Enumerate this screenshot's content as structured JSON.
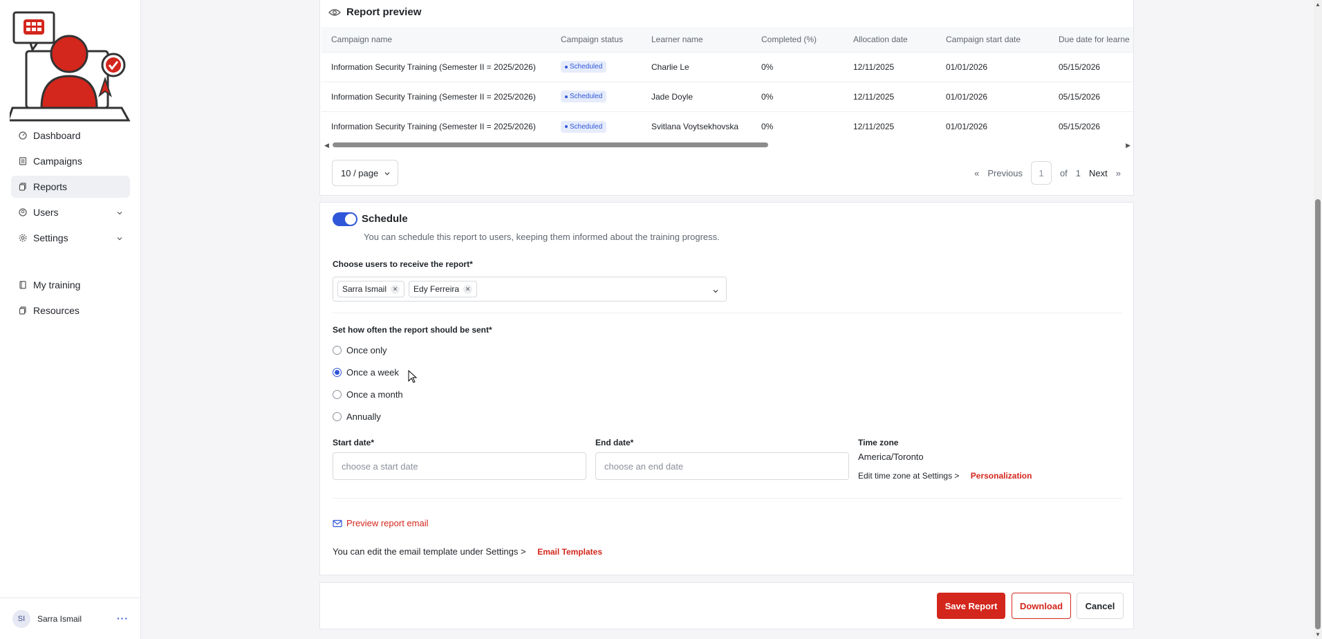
{
  "sidebar": {
    "items": [
      {
        "label": "Dashboard",
        "icon": "gauge-icon"
      },
      {
        "label": "Campaigns",
        "icon": "list-icon"
      },
      {
        "label": "Reports",
        "icon": "copy-icon"
      },
      {
        "label": "Users",
        "icon": "user-circle-icon"
      },
      {
        "label": "Settings",
        "icon": "gear-icon"
      },
      {
        "label": "My training",
        "icon": "book-icon"
      },
      {
        "label": "Resources",
        "icon": "files-icon"
      }
    ],
    "user": {
      "initials": "SI",
      "name": "Sarra Ismail"
    }
  },
  "preview": {
    "title": "Report preview",
    "columns": [
      "Campaign name",
      "Campaign status",
      "Learner name",
      "Completed (%)",
      "Allocation date",
      "Campaign start date",
      "Due date for learne"
    ],
    "rows": [
      {
        "campaign": "Information Security Training (Semester II = 2025/2026)",
        "status": "Scheduled",
        "learner": "Charlie Le",
        "completed": "0%",
        "allocation": "12/11/2025",
        "start": "01/01/2026",
        "due": "05/15/2026"
      },
      {
        "campaign": "Information Security Training (Semester II = 2025/2026)",
        "status": "Scheduled",
        "learner": "Jade Doyle",
        "completed": "0%",
        "allocation": "12/11/2025",
        "start": "01/01/2026",
        "due": "05/15/2026"
      },
      {
        "campaign": "Information Security Training (Semester II = 2025/2026)",
        "status": "Scheduled",
        "learner": "Svitlana Voytsekhovska",
        "completed": "0%",
        "allocation": "12/11/2025",
        "start": "01/01/2026",
        "due": "05/15/2026"
      }
    ],
    "page_size": "10 / page",
    "pager": {
      "previous": "Previous",
      "current": "1",
      "of": "of",
      "total": "1",
      "next": "Next"
    }
  },
  "schedule": {
    "title": "Schedule",
    "description": "You can schedule this report to users, keeping them informed about the training progress.",
    "recipients_label": "Choose users to receive the report*",
    "recipients": [
      "Sarra Ismail",
      "Edy Ferreira"
    ],
    "frequency_label": "Set how often the report should be sent*",
    "frequency_options": [
      "Once only",
      "Once a week",
      "Once a month",
      "Annually"
    ],
    "selected_frequency": "Once a week",
    "start_date_label": "Start date*",
    "start_date_placeholder": "choose a start date",
    "end_date_label": "End date*",
    "end_date_placeholder": "choose an end date",
    "timezone_label": "Time zone",
    "timezone_value": "America/Toronto",
    "timezone_note": "Edit time zone at Settings >",
    "timezone_link": "Personalization",
    "preview_email": "Preview report email",
    "template_note": "You can edit the email template under Settings >",
    "template_link": "Email Templates"
  },
  "actions": {
    "save": "Save Report",
    "download": "Download",
    "cancel": "Cancel"
  },
  "colors": {
    "accent": "#2f56d8",
    "brand_red": "#d3261c"
  }
}
